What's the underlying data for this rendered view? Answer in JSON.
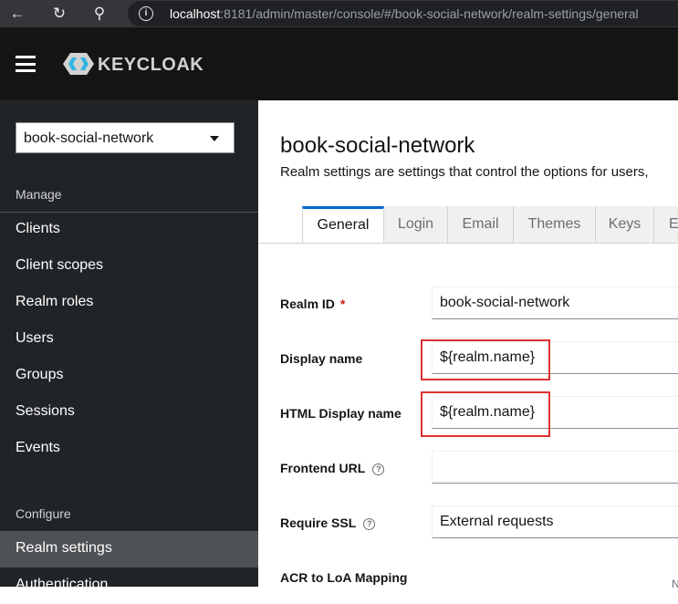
{
  "browser": {
    "url_host": "localhost",
    "url_rest": ":8181/admin/master/console/#/book-social-network/realm-settings/general"
  },
  "brand": {
    "logo_text": "KEYCLOAK"
  },
  "sidebar": {
    "realm_selector": "book-social-network",
    "manage_title": "Manage",
    "manage_items": [
      {
        "label": "Clients"
      },
      {
        "label": "Client scopes"
      },
      {
        "label": "Realm roles"
      },
      {
        "label": "Users"
      },
      {
        "label": "Groups"
      },
      {
        "label": "Sessions"
      },
      {
        "label": "Events"
      }
    ],
    "configure_title": "Configure",
    "configure_items": [
      {
        "label": "Realm settings",
        "active": true
      },
      {
        "label": "Authentication"
      }
    ]
  },
  "page": {
    "title": "book-social-network",
    "description": "Realm settings are settings that control the options for users,"
  },
  "tabs": [
    {
      "label": "General",
      "active": true
    },
    {
      "label": "Login"
    },
    {
      "label": "Email"
    },
    {
      "label": "Themes"
    },
    {
      "label": "Keys"
    },
    {
      "label": "E"
    }
  ],
  "form": {
    "realm_id": {
      "label": "Realm ID",
      "required_mark": "*",
      "value": "book-social-network"
    },
    "display_name": {
      "label": "Display name",
      "value": "${realm.name}"
    },
    "html_display_name": {
      "label": "HTML Display name",
      "value": "${realm.name}"
    },
    "frontend_url": {
      "label": "Frontend URL",
      "value": ""
    },
    "require_ssl": {
      "label": "Require SSL",
      "value": "External requests"
    },
    "acr_mapping": {
      "label": "ACR to LoA Mapping",
      "trailing": "N"
    }
  },
  "highlight_color": "#e03030",
  "accent_color": "#0066cc"
}
